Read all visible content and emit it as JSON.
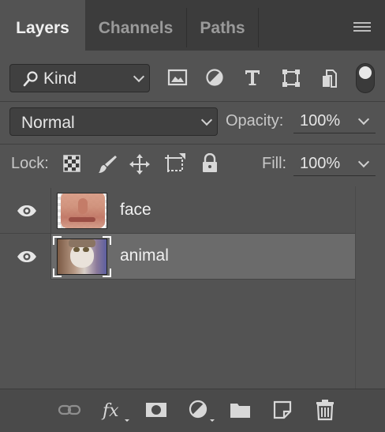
{
  "tabs": [
    {
      "label": "Layers",
      "active": true
    },
    {
      "label": "Channels",
      "active": false
    },
    {
      "label": "Paths",
      "active": false
    }
  ],
  "filter": {
    "kind_label": "Kind",
    "icons": [
      "image-filter-icon",
      "adjustment-filter-icon",
      "type-filter-icon",
      "shape-filter-icon",
      "smart-object-filter-icon"
    ]
  },
  "blend": {
    "mode": "Normal",
    "opacity_label": "Opacity:",
    "opacity_value": "100%"
  },
  "lock": {
    "label": "Lock:",
    "fill_label": "Fill:",
    "fill_value": "100%"
  },
  "layers": [
    {
      "name": "face",
      "visible": true,
      "selected": false
    },
    {
      "name": "animal",
      "visible": true,
      "selected": true
    }
  ],
  "bottom_icons": [
    "link-icon",
    "fx-icon",
    "mask-icon",
    "adjustment-icon",
    "folder-icon",
    "new-layer-icon",
    "trash-icon"
  ],
  "colors": {
    "panel": "#535353",
    "tabbar": "#3c3c3c",
    "selected_row": "#6b6b6b"
  }
}
